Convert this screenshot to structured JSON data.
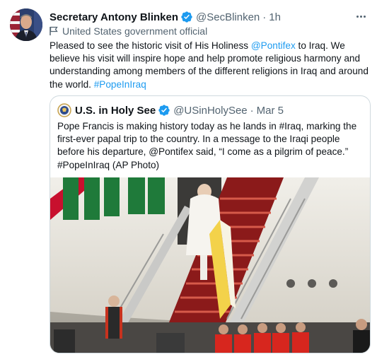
{
  "tweet": {
    "author_name": "Secretary Antony Blinken",
    "handle": "@SecBlinken",
    "separator": "·",
    "time": "1h",
    "label_icon": "flag-icon",
    "label": "United States government official",
    "body_parts": [
      {
        "text": "Pleased to see the historic visit of His Holiness ",
        "link": false
      },
      {
        "text": "@Pontifex",
        "link": true
      },
      {
        "text": " to Iraq. We believe his visit will inspire hope and help promote religious harmony and understanding among members of the different religions in Iraq and around the world. ",
        "link": false
      },
      {
        "text": "#PopeInIraq",
        "link": true
      }
    ]
  },
  "quoted": {
    "author_name": "U.S. in Holy See",
    "handle": "@USinHolySee",
    "separator": "·",
    "time": "Mar 5",
    "body": "Pope Francis is making history today as he lands in #Iraq, marking the first-ever papal trip to the country. In a message to the Iraqi people before his departure, @Pontifex said, “I come as a pilgrim of peace.” #PopeInIraq (AP Photo)"
  },
  "colors": {
    "link": "#1d9bf0",
    "verified": "#1d9bf0",
    "secondary_text": "#536471",
    "border": "#cfd9de"
  }
}
